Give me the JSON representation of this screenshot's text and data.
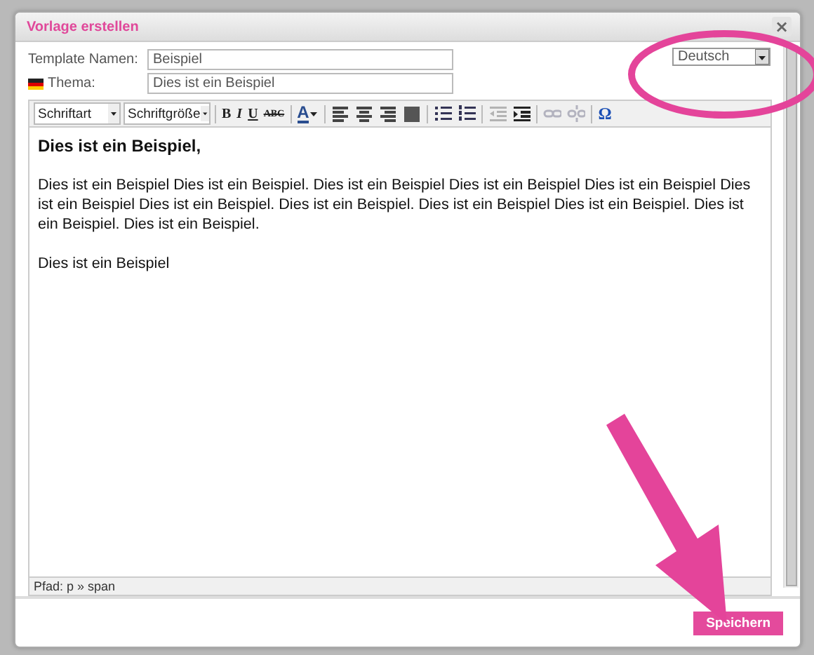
{
  "dialog": {
    "title": "Vorlage erstellen",
    "close": "×"
  },
  "fields": [
    {
      "label": "Template Namen:",
      "value": "Beispiel",
      "flag": false
    },
    {
      "label": "Thema:",
      "value": "Dies ist ein Beispiel",
      "flag": true
    }
  ],
  "language": {
    "value": "Deutsch"
  },
  "toolbar": [
    {
      "kind": "select",
      "label": "Schriftart"
    },
    {
      "kind": "select",
      "label": "Schriftgröße"
    },
    {
      "kind": "sep"
    },
    {
      "kind": "bold",
      "label": "B"
    },
    {
      "kind": "italic",
      "label": "I"
    },
    {
      "kind": "underline",
      "label": "U"
    },
    {
      "kind": "strike",
      "label": "ABC"
    },
    {
      "kind": "sep"
    },
    {
      "kind": "color",
      "label": "A"
    },
    {
      "kind": "sep"
    },
    {
      "kind": "align-left"
    },
    {
      "kind": "align-center"
    },
    {
      "kind": "align-right"
    },
    {
      "kind": "align-justify"
    },
    {
      "kind": "sep"
    },
    {
      "kind": "bullets"
    },
    {
      "kind": "numbers"
    },
    {
      "kind": "sep"
    },
    {
      "kind": "outdent",
      "disabled": true
    },
    {
      "kind": "indent",
      "disabled": false
    },
    {
      "kind": "sep"
    },
    {
      "kind": "link",
      "disabled": true
    },
    {
      "kind": "unlink",
      "disabled": true
    },
    {
      "kind": "sep"
    },
    {
      "kind": "symbol",
      "label": "Ω"
    }
  ],
  "editor": {
    "paragraphs": [
      {
        "kind": "heading",
        "text": "Dies ist ein Beispiel,"
      },
      {
        "kind": "text",
        "text": "Dies ist ein Beispiel Dies ist ein Beispiel. Dies ist ein Beispiel Dies ist ein Beispiel Dies ist ein Beispiel Dies ist ein Beispiel Dies ist ein Beispiel. Dies ist ein Beispiel. Dies ist ein Beispiel Dies ist ein Beispiel. Dies ist ein Beispiel. Dies ist ein Beispiel."
      },
      {
        "kind": "text",
        "text": "Dies ist ein Beispiel"
      }
    ],
    "path": "Pfad: p » span"
  },
  "save_button": "Speichern"
}
